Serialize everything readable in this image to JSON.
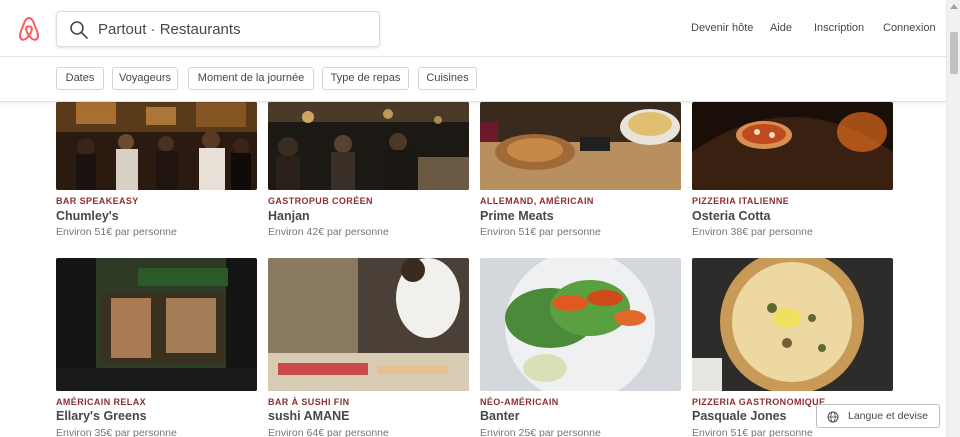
{
  "header": {
    "search_text": "Partout · Restaurants",
    "nav": [
      "Devenir hôte",
      "Aide",
      "Inscription",
      "Connexion"
    ]
  },
  "filters": [
    "Dates",
    "Voyageurs",
    "Moment de la journée",
    "Type de repas",
    "Cuisines"
  ],
  "restaurants": [
    {
      "category": "BAR SPEAKEASY",
      "name": "Chumley's",
      "price": "Environ 51€ par personne"
    },
    {
      "category": "GASTROPUB CORÉEN",
      "name": "Hanjan",
      "price": "Environ 42€ par personne"
    },
    {
      "category": "ALLEMAND, AMÉRICAIN",
      "name": "Prime Meats",
      "price": "Environ 51€ par personne"
    },
    {
      "category": "PIZZERIA ITALIENNE",
      "name": "Osteria Cotta",
      "price": "Environ 38€ par personne"
    },
    {
      "category": "AMÉRICAIN RELAX",
      "name": "Ellary's Greens",
      "price": "Environ 35€ par personne"
    },
    {
      "category": "BAR À SUSHI FIN",
      "name": "sushi AMANE",
      "price": "Environ 64€ par personne"
    },
    {
      "category": "NÉO-AMÉRICAIN",
      "name": "Banter",
      "price": "Environ 25€ par personne"
    },
    {
      "category": "PIZZERIA GASTRONOMIQUE",
      "name": "Pasquale Jones",
      "price": "Environ 51€ par personne"
    }
  ],
  "lang_button": "Langue et devise",
  "colors": {
    "brand": "#FF5A5F",
    "category": "#8C2F2F"
  }
}
